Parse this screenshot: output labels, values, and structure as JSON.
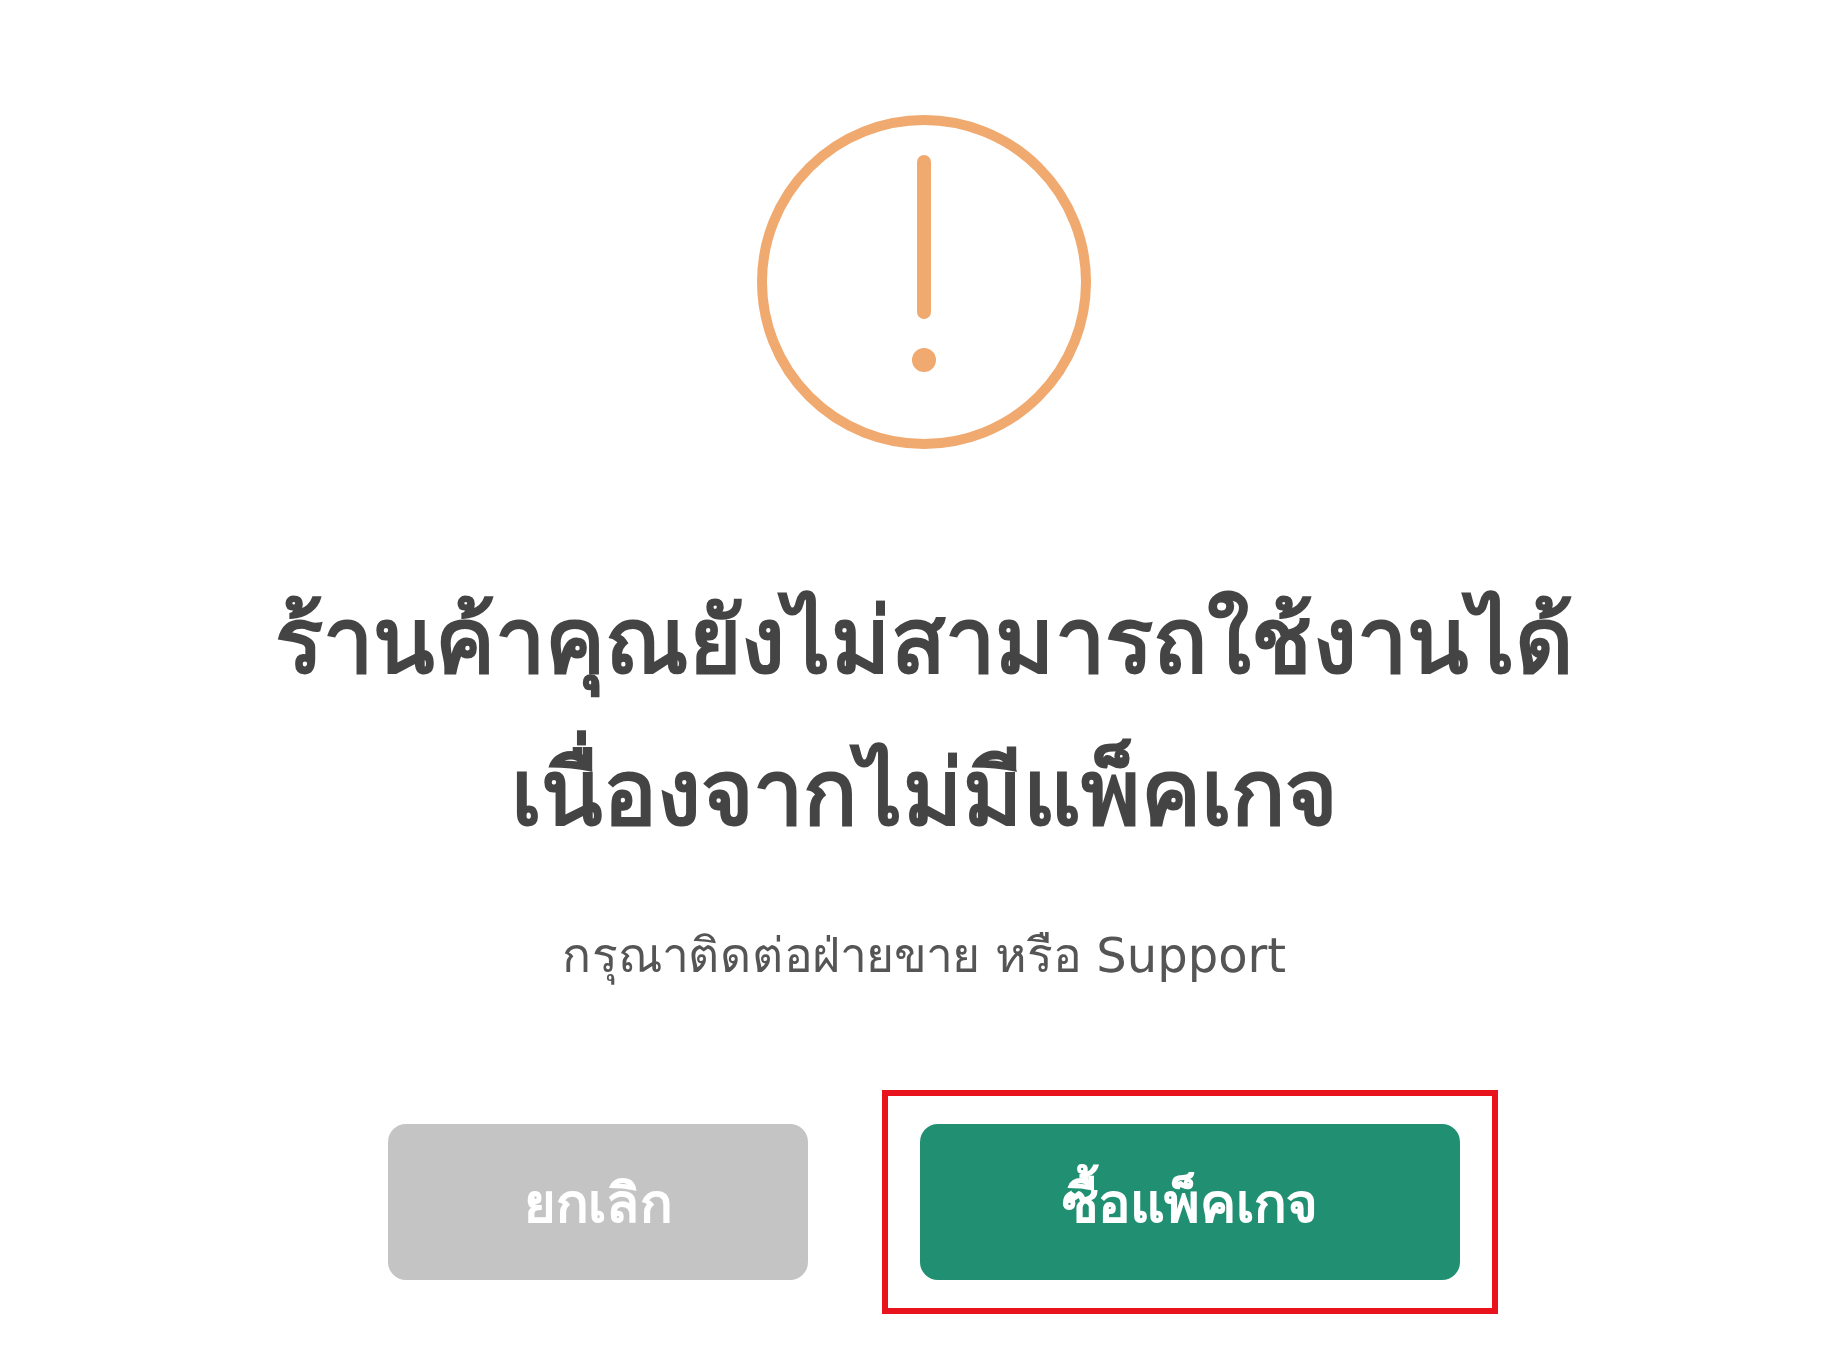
{
  "dialog": {
    "title_lines": [
      "ร้านค้าคุณยังไม่สามารถใช้งานได้",
      "เนื่องจากไม่มีแพ็คเกจ"
    ],
    "message": "กรุณาติดต่อฝ่ายขาย หรือ Support",
    "buttons": [
      {
        "label": "ยกเลิก",
        "kind": "secondary",
        "highlighted": false
      },
      {
        "label": "ซื้อแพ็คเกจ",
        "kind": "primary",
        "highlighted": true
      }
    ]
  }
}
